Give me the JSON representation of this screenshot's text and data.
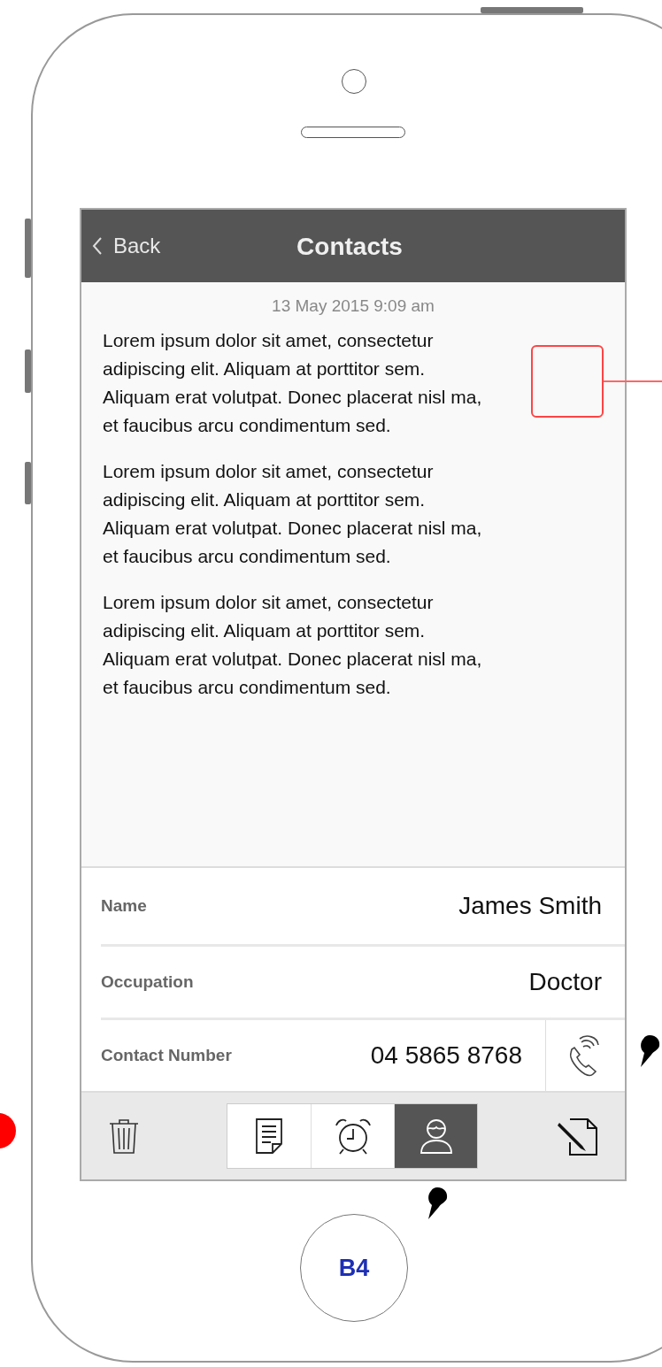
{
  "header": {
    "back_label": "Back",
    "title": "Contacts"
  },
  "timestamp": "13 May 2015 9:09 am",
  "paragraphs": [
    "Lorem ipsum dolor sit amet, consectetur\nadipiscing elit. Aliquam at porttitor sem.\nAliquam erat volutpat. Donec placerat nisl ma,\net faucibus arcu condimentum sed.",
    "Lorem ipsum dolor sit amet, consectetur\nadipiscing elit. Aliquam at porttitor sem.\nAliquam erat volutpat. Donec placerat nisl ma,\net faucibus arcu condimentum sed.",
    "Lorem ipsum dolor sit amet, consectetur\nadipiscing elit. Aliquam at porttitor sem.\nAliquam erat volutpat. Donec placerat nisl ma,\net faucibus arcu condimentum sed."
  ],
  "fields": [
    {
      "kind": "text",
      "label": "Name",
      "value": "James Smith"
    },
    {
      "kind": "text",
      "label": "Occupation",
      "value": "Doctor"
    },
    {
      "kind": "phone",
      "label": "Contact Number",
      "value": "04 5865 8768"
    }
  ],
  "tabs": [
    {
      "kind": "notes",
      "selected": false
    },
    {
      "kind": "alarm",
      "selected": false
    },
    {
      "kind": "contact",
      "selected": true
    }
  ],
  "home_button": {
    "label": "B4"
  }
}
